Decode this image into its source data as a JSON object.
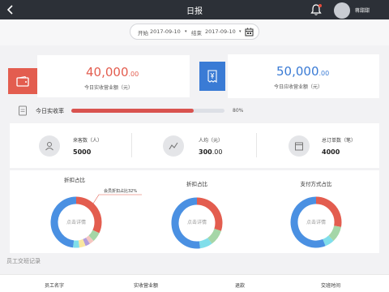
{
  "header": {
    "title": "日报",
    "user_name": "蒋甜甜"
  },
  "date_filter": {
    "start_label": "开始",
    "start_date": "2017-09-10",
    "end_label": "结束",
    "end_date": "2017-09-10"
  },
  "revenue": {
    "actual_amount": "40,000",
    "actual_decimals": ".00",
    "actual_label": "今日实收营业额（元）",
    "receivable_amount": "50,000",
    "receivable_decimals": ".00",
    "receivable_label": "今日应收营业额（元）"
  },
  "collection_rate": {
    "label": "今日实收率",
    "percent_text": "80%",
    "value": 80
  },
  "stats": [
    {
      "label": "来客数（人）",
      "value": "5000"
    },
    {
      "label": "人均（元）",
      "value": "300",
      "decimals": ".00"
    },
    {
      "label": "总订单数（笔）",
      "value": "4000"
    }
  ],
  "pies": [
    {
      "title": "折扣占比",
      "center": "点击详情",
      "callout": "会员折扣占比32%"
    },
    {
      "title": "折扣占比",
      "center": "点击详情"
    },
    {
      "title": "支付方式占比",
      "center": "点击详情"
    }
  ],
  "pie_segments": [
    [
      {
        "color": "#e35d4f",
        "value": 32
      },
      {
        "color": "#a5d6a7",
        "value": 6
      },
      {
        "color": "#f5c6c0",
        "value": 3
      },
      {
        "color": "#b39ddb",
        "value": 3
      },
      {
        "color": "#f9e79f",
        "value": 4
      },
      {
        "color": "#80deea",
        "value": 4
      },
      {
        "color": "#4a90e2",
        "value": 48
      }
    ],
    [
      {
        "color": "#e35d4f",
        "value": 30
      },
      {
        "color": "#a5d6a7",
        "value": 10
      },
      {
        "color": "#80deea",
        "value": 8
      },
      {
        "color": "#4a90e2",
        "value": 52
      }
    ],
    [
      {
        "color": "#e35d4f",
        "value": 28
      },
      {
        "color": "#a5d6a7",
        "value": 10
      },
      {
        "color": "#80deea",
        "value": 6
      },
      {
        "color": "#4a90e2",
        "value": 56
      }
    ]
  ],
  "shift_section": {
    "title": "员工交班记录"
  },
  "table": {
    "columns": [
      "员工名字",
      "实收营业额",
      "退款",
      "交班时间"
    ]
  },
  "colors": {
    "red": "#e35d4f",
    "blue": "#4a90e2",
    "header_bg": "#2c3037"
  }
}
